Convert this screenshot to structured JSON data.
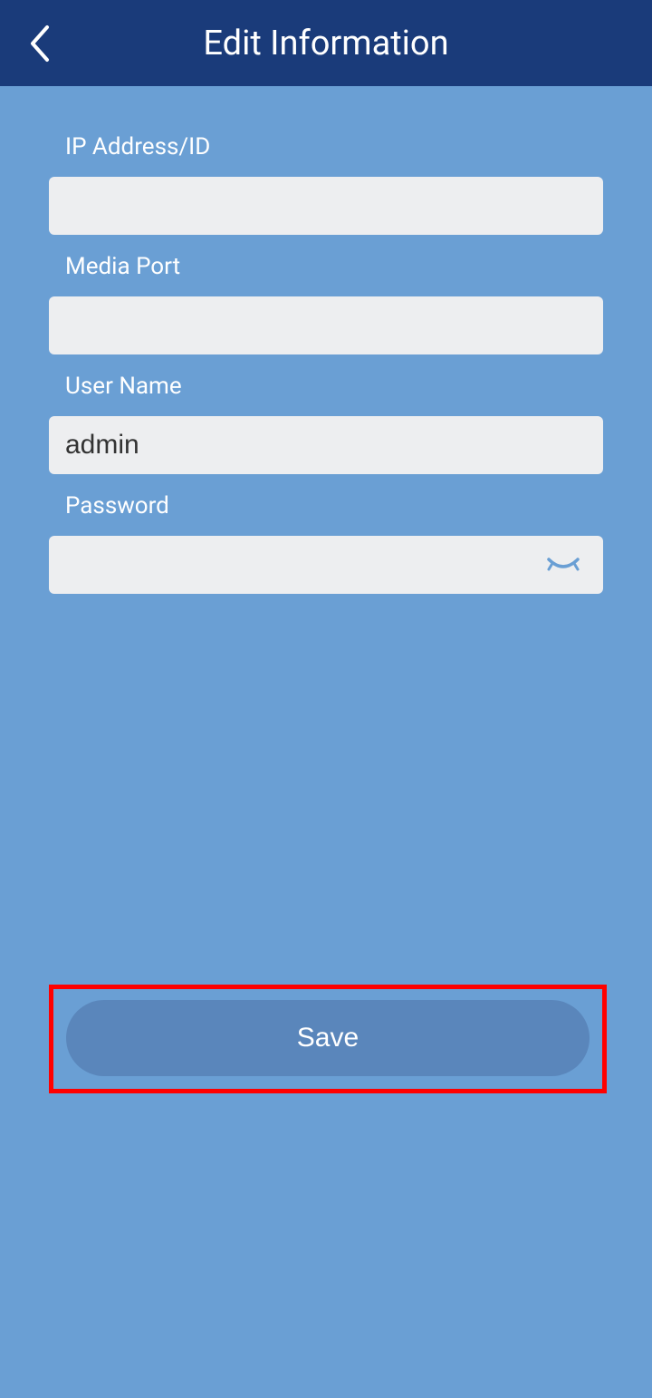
{
  "header": {
    "title": "Edit Information"
  },
  "form": {
    "ip_address": {
      "label": "IP Address/ID",
      "value": ""
    },
    "media_port": {
      "label": "Media Port",
      "value": ""
    },
    "user_name": {
      "label": "User Name",
      "value": "admin"
    },
    "password": {
      "label": "Password",
      "value": ""
    }
  },
  "actions": {
    "save_label": "Save"
  }
}
